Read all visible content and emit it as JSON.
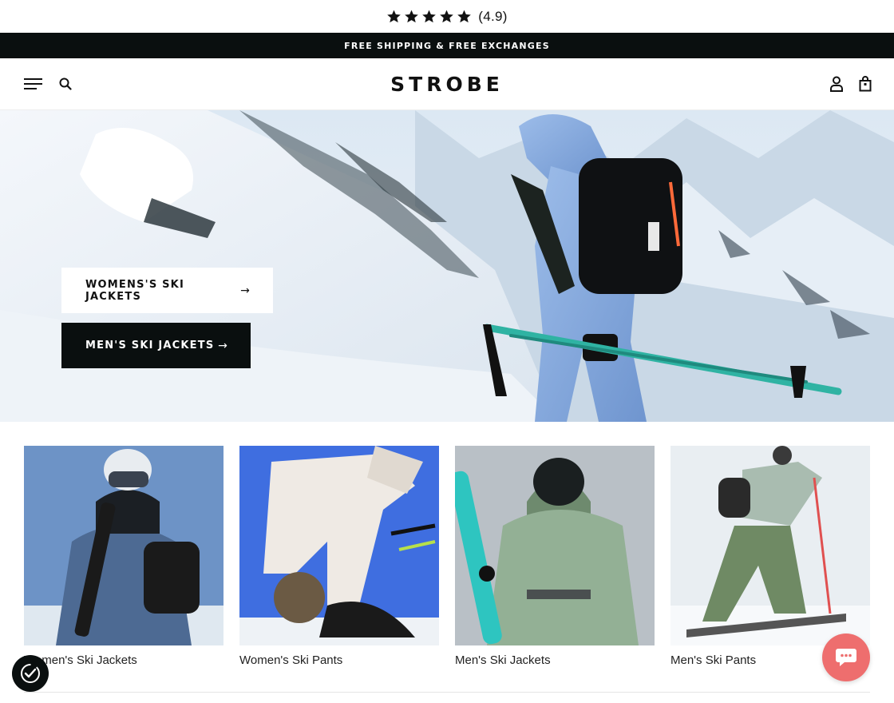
{
  "rating": {
    "stars": 5,
    "score_text": "(4.9)"
  },
  "announcement": {
    "text": "FREE SHIPPING & FREE EXCHANGES"
  },
  "header": {
    "logo": "STROBE",
    "icons": [
      "menu-icon",
      "search-icon",
      "account-icon",
      "cart-icon"
    ]
  },
  "hero": {
    "buttons": [
      {
        "label": "WOMENS'S SKI JACKETS",
        "arrow": "→",
        "style": "light"
      },
      {
        "label": "MEN'S SKI JACKETS",
        "arrow": "→",
        "style": "dark"
      }
    ]
  },
  "categories": [
    {
      "label": "Women's Ski Jackets"
    },
    {
      "label": "Women's Ski Pants"
    },
    {
      "label": "Men's Ski Jackets"
    },
    {
      "label": "Men's Ski Pants"
    }
  ],
  "colors": {
    "brand_dark": "#0a0f0f",
    "chat_bubble": "#ee6e6e",
    "sky_blue": "#5e86b8",
    "jacket_blue": "#8fb2e6",
    "pole_teal": "#2fb3a3"
  }
}
